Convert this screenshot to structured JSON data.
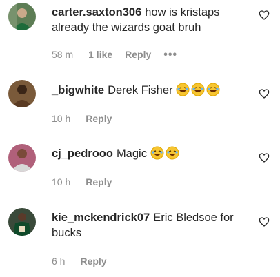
{
  "comments": [
    {
      "username": "carter.saxton306",
      "text": "how is kristaps already the wizards goat bruh",
      "emoji_count": 0,
      "time": "58 m",
      "likes": "1 like",
      "reply": "Reply",
      "more": "•••"
    },
    {
      "username": "_bigwhite",
      "text": "Derek Fisher",
      "emoji_count": 3,
      "time": "10 h",
      "reply": "Reply"
    },
    {
      "username": "cj_pedrooo",
      "text": "Magic",
      "emoji_count": 2,
      "time": "10 h",
      "reply": "Reply"
    },
    {
      "username": "kie_mckendrick07",
      "text": "Eric Bledsoe for bucks",
      "emoji_count": 0,
      "time": "6 h",
      "reply": "Reply"
    }
  ],
  "icons": {
    "like": "heart-outline-icon",
    "emoji": "face-with-tears-of-joy"
  },
  "colors": {
    "text": "#262626",
    "secondary": "#8e8e8e",
    "emoji": "#f7c531"
  }
}
